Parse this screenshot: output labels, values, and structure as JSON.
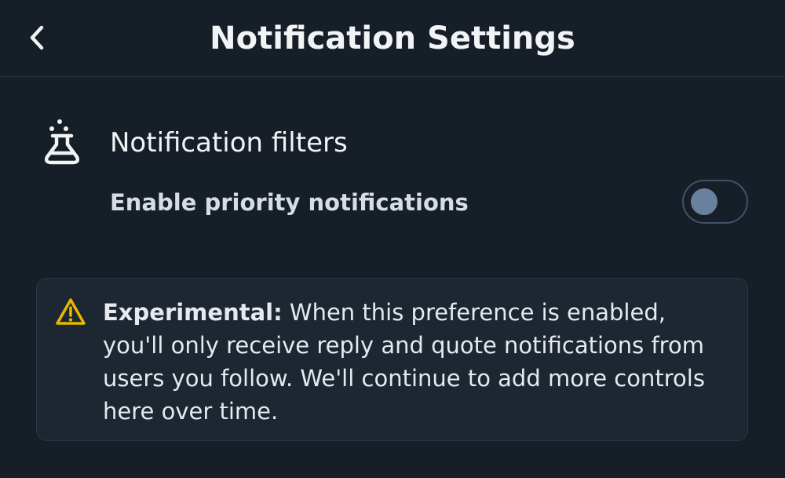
{
  "header": {
    "title": "Notification Settings"
  },
  "section": {
    "icon": "flask-icon",
    "title": "Notification filters"
  },
  "setting": {
    "label": "Enable priority notifications",
    "enabled": false
  },
  "notice": {
    "icon": "warning-icon",
    "title": "Experimental:",
    "body": " When this preference is enabled, you'll only receive reply and quote notifications from users you follow. We'll continue to add more controls here over time."
  },
  "colors": {
    "background": "#161e27",
    "notice_background": "#1c2731",
    "warning": "#e6b800",
    "toggle_knob": "#6a809f"
  }
}
